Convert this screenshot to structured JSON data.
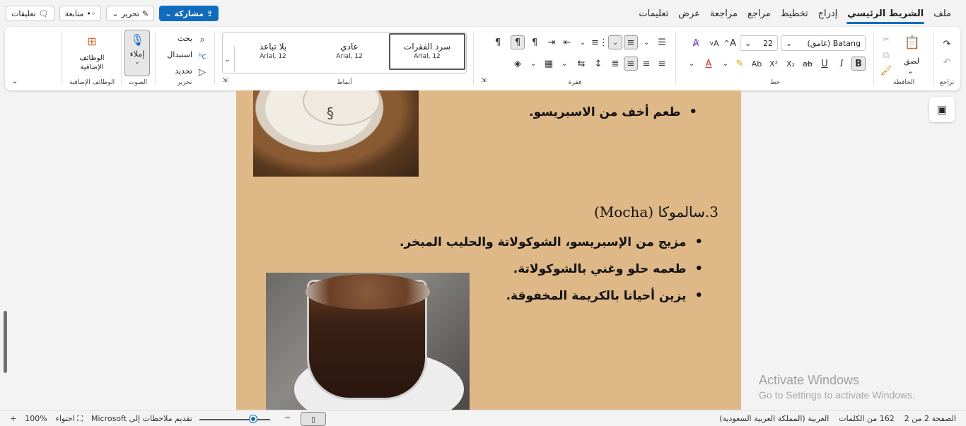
{
  "tabs": [
    "ملف",
    "الشريط الرئيسي",
    "إدراج",
    "تخطيط",
    "مراجع",
    "مراجعة",
    "عرض",
    "تعليمات"
  ],
  "active_tab": "الشريط الرئيسي",
  "top_buttons": {
    "comments": "تعليقات",
    "follow": "متابعة",
    "editing": "تحرير",
    "share": "مشاركة"
  },
  "ribbon": {
    "undo_group": "تراجع",
    "clipboard_group": "الحافظة",
    "paste_label": "لصق",
    "font_group": "خط",
    "font_name": "Batang (غامق)",
    "font_size": "22",
    "paragraph_group": "فقرة",
    "styles_group": "أنماط",
    "styles": [
      {
        "name": "سرد الفقرات",
        "font": "Arial, 12"
      },
      {
        "name": "عادي",
        "font": "Arial, 12"
      },
      {
        "name": "بلا تباعد",
        "font": "Arial, 12"
      }
    ],
    "editing_group": "تحرير",
    "find": "بحث",
    "replace": "استبدال",
    "select": "تحديد",
    "voice_group": "الصوت",
    "dictate": "إملاء",
    "addins_group": "الوظائف الإضافية",
    "addins_label": "الوظائف الإضافية"
  },
  "document": {
    "bullet_top": "طعم أخف من الاسبريسو.",
    "heading": "3.سالموكا (Mocha)",
    "bullets": [
      "مزيج من الإسبريسو، الشوكولاتة والحليب المبخر.",
      "طعمه حلو وغني بالشوكولاتة.",
      "يزين أحيانا بالكريمة المخفوقة."
    ]
  },
  "watermark": {
    "line1": "Activate Windows",
    "line2": "Go to Settings to activate Windows."
  },
  "status": {
    "page": "الصفحة 2 من 2",
    "words": "162 من الكلمات",
    "language": "العربية (المملكة العربية السعودية)",
    "zoom": "100%",
    "focus": "احتواء",
    "feedback": "تقديم ملاحظات إلى Microsoft"
  },
  "colors": {
    "accent": "#0f6cbd",
    "page_bg": "#dfb887",
    "font_color": "#d13438"
  }
}
